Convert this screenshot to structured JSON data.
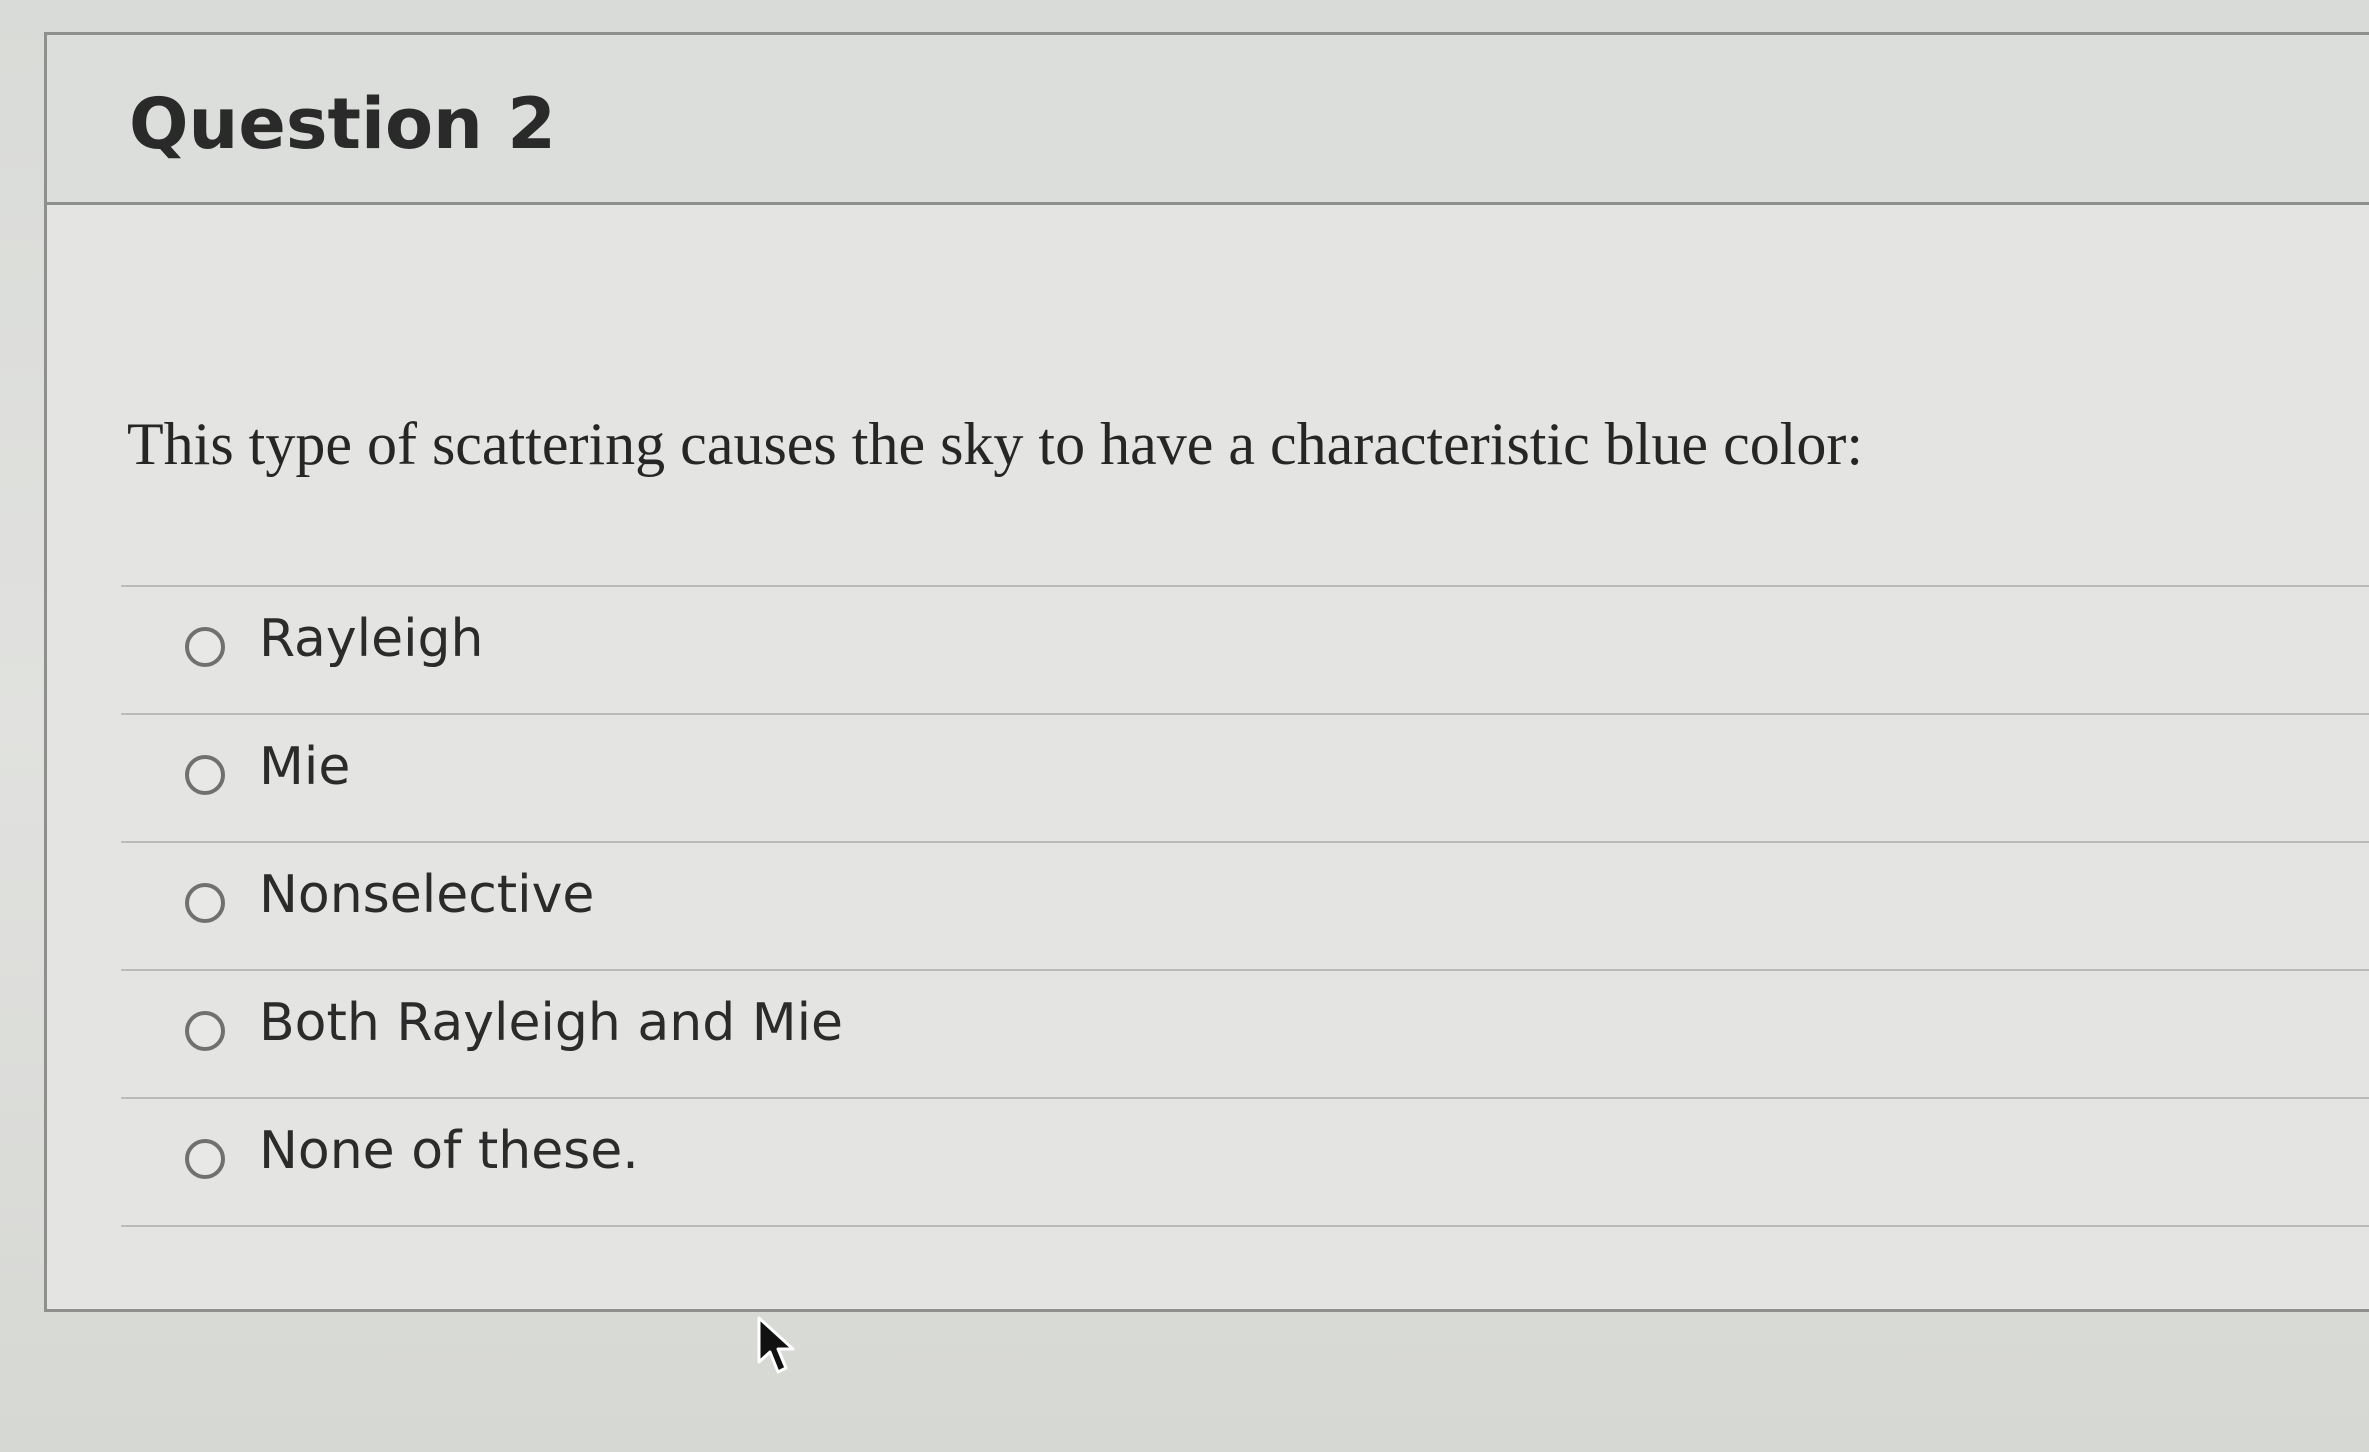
{
  "question": {
    "title": "Question 2",
    "text": "This type of scattering causes the sky to have a characteristic blue color:"
  },
  "answers": [
    {
      "label": "Rayleigh",
      "selected": false
    },
    {
      "label": "Mie",
      "selected": false
    },
    {
      "label": "Nonselective",
      "selected": false
    },
    {
      "label": "Both Rayleigh and Mie",
      "selected": false
    },
    {
      "label": "None of these.",
      "selected": false
    }
  ],
  "icons": {
    "radio": "radio-unchecked-icon",
    "cursor": "mouse-pointer-icon"
  }
}
